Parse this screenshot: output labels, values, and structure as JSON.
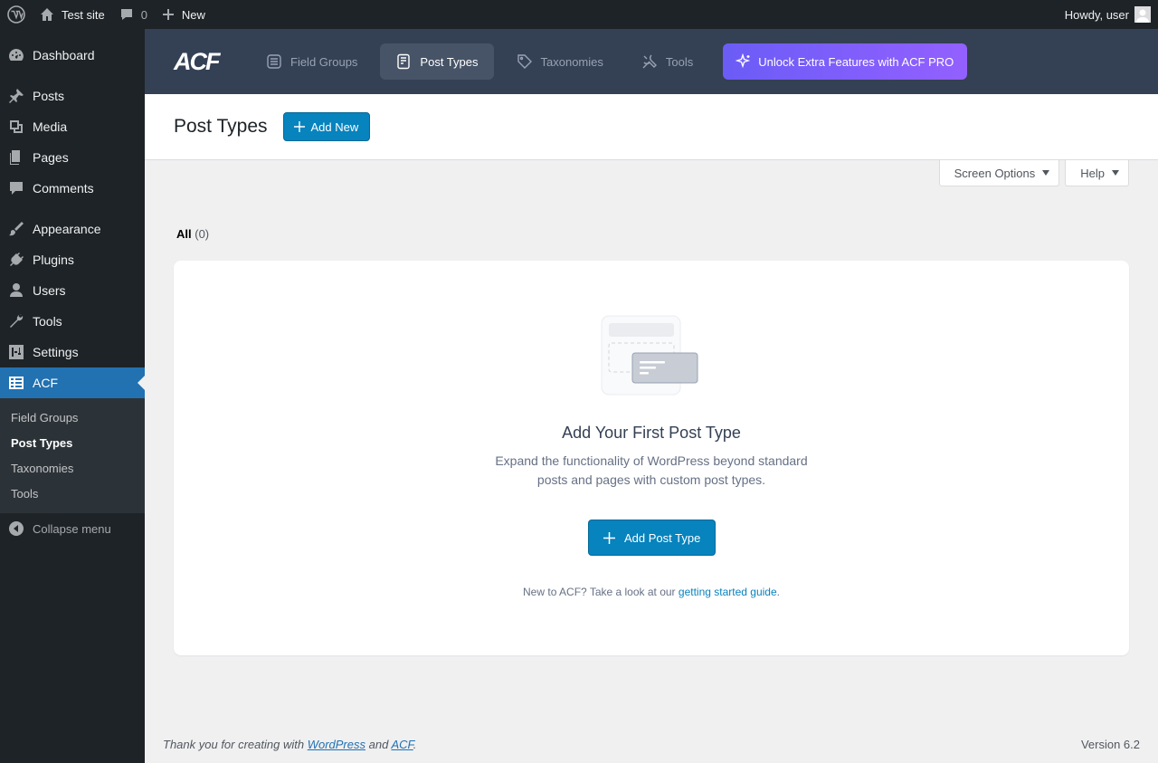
{
  "adminbar": {
    "site_name": "Test site",
    "comments_count": "0",
    "new_label": "New",
    "howdy": "Howdy, user"
  },
  "sidebar": {
    "items": [
      {
        "label": "Dashboard",
        "icon": "dashboard-icon"
      },
      {
        "label": "Posts",
        "icon": "pin-icon"
      },
      {
        "label": "Media",
        "icon": "media-icon"
      },
      {
        "label": "Pages",
        "icon": "pages-icon"
      },
      {
        "label": "Comments",
        "icon": "comment-icon"
      },
      {
        "label": "Appearance",
        "icon": "brush-icon"
      },
      {
        "label": "Plugins",
        "icon": "plugin-icon"
      },
      {
        "label": "Users",
        "icon": "user-icon"
      },
      {
        "label": "Tools",
        "icon": "wrench-icon"
      },
      {
        "label": "Settings",
        "icon": "sliders-icon"
      },
      {
        "label": "ACF",
        "icon": "acf-grid-icon"
      }
    ],
    "submenu": [
      "Field Groups",
      "Post Types",
      "Taxonomies",
      "Tools"
    ],
    "collapse_label": "Collapse menu"
  },
  "acf_header": {
    "logo": "ACF",
    "tabs": [
      "Field Groups",
      "Post Types",
      "Taxonomies",
      "Tools"
    ],
    "pro_label": "Unlock Extra Features with ACF PRO"
  },
  "page": {
    "title": "Post Types",
    "add_new_label": "Add New"
  },
  "screen_options": {
    "screen_options_label": "Screen Options",
    "help_label": "Help"
  },
  "filters": {
    "all_label": "All",
    "all_count": "(0)"
  },
  "empty_state": {
    "title": "Add Your First Post Type",
    "description": "Expand the functionality of WordPress beyond standard posts and pages with custom post types.",
    "button_label": "Add Post Type",
    "guide_prefix": "New to ACF? Take a look at our ",
    "guide_link": "getting started guide",
    "guide_suffix": "."
  },
  "footer": {
    "prefix": "Thank you for creating with ",
    "wordpress_link": "WordPress",
    "and": " and ",
    "acf_link": "ACF",
    "suffix": ".",
    "version": "Version 6.2"
  },
  "colors": {
    "admin_dark": "#1d2327",
    "acf_header": "#344054",
    "primary": "#0783be",
    "current_menu": "#2271b1"
  }
}
